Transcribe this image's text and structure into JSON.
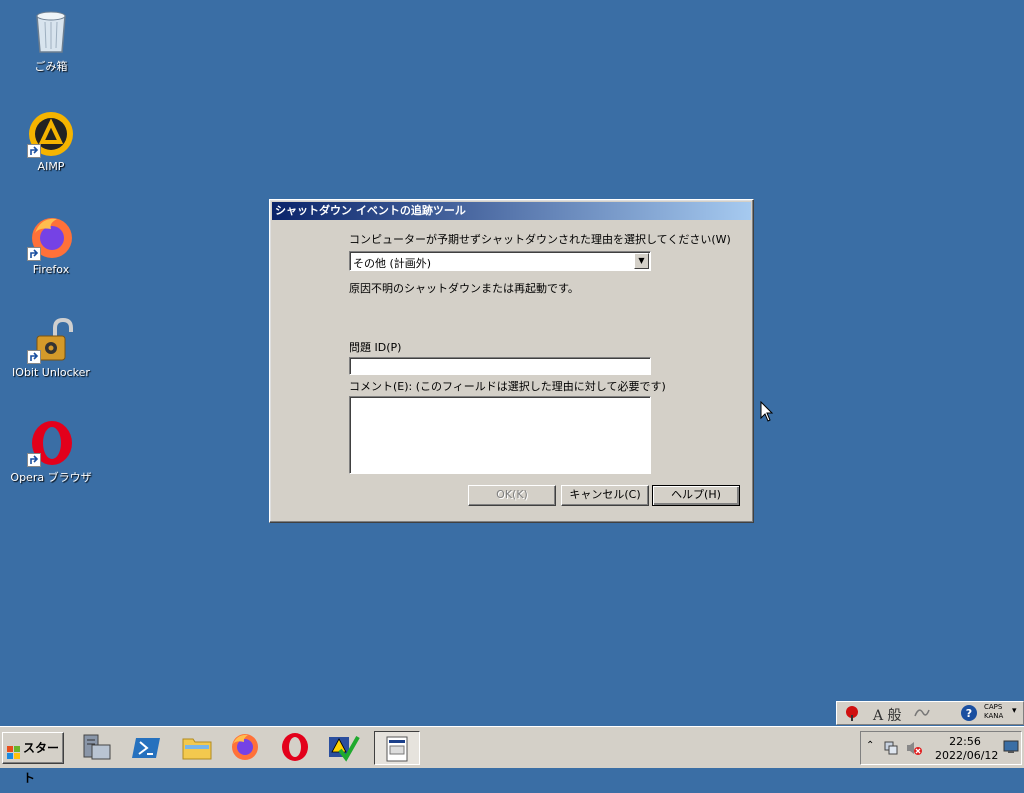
{
  "desktop": {
    "icons": [
      {
        "label": "ごみ箱"
      },
      {
        "label": "AIMP"
      },
      {
        "label": "Firefox"
      },
      {
        "label": "IObit Unlocker"
      },
      {
        "label": "Opera ブラウザ"
      }
    ]
  },
  "dialog": {
    "title": "シャットダウン イベントの追跡ツール",
    "reason_label": "コンピューターが予期せずシャットダウンされた理由を選択してください(W)",
    "reason_value": "その他 (計画外)",
    "reason_description": "原因不明のシャットダウンまたは再起動です。",
    "problem_id_label": "問題 ID(P)",
    "problem_id_value": "",
    "comment_label": "コメント(E): (このフィールドは選択した理由に対して必要です)",
    "comment_value": "",
    "ok_label": "OK(K)",
    "cancel_label": "キャンセル(C)",
    "help_label": "ヘルプ(H)"
  },
  "langbar": {
    "mode": "A 般",
    "caps": "CAPS",
    "kana": "KANA"
  },
  "taskbar": {
    "start_label": "スタート",
    "time": "22:56",
    "date": "2022/06/12"
  },
  "colors": {
    "desktop": "#3a6ea5",
    "titlebar_start": "#0a246a",
    "titlebar_end": "#a6caf0",
    "face": "#d4d0c8"
  }
}
